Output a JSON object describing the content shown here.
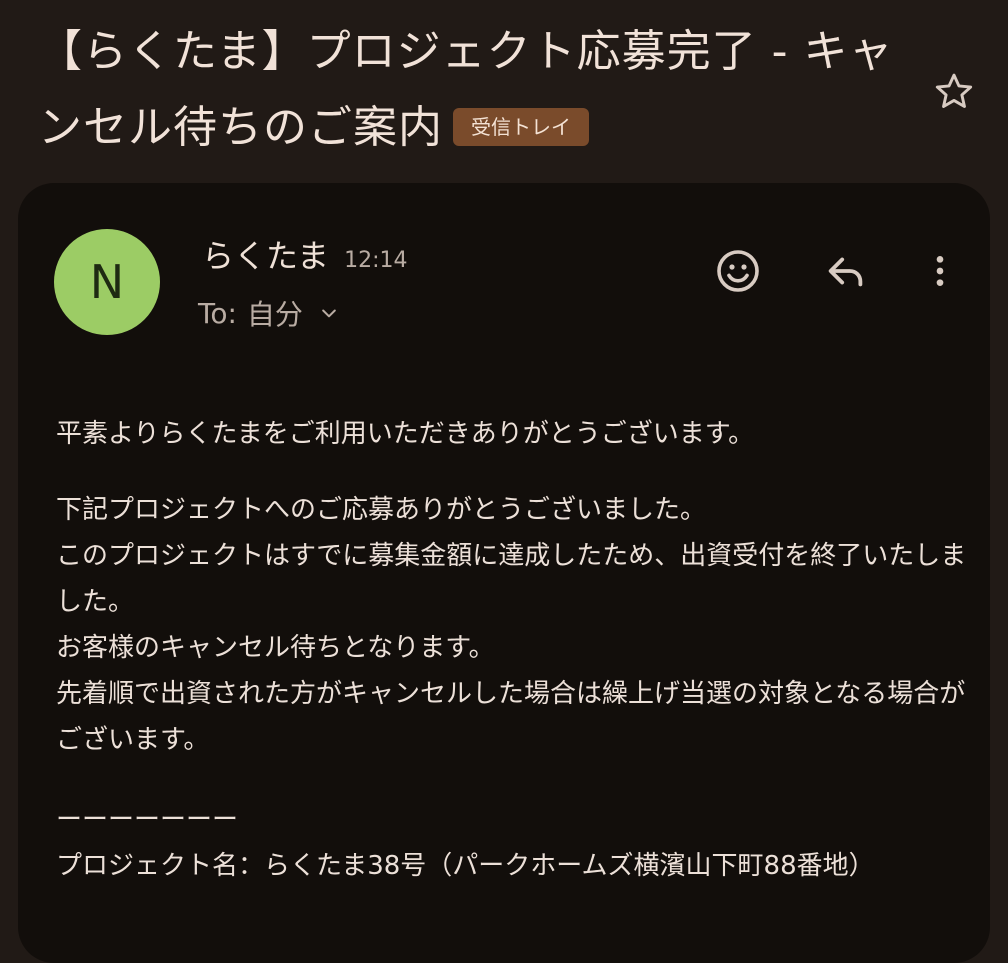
{
  "email": {
    "subject": "【らくたま】プロジェクト応募完了 - キャンセル待ちのご案内",
    "label_badge": "受信トレイ",
    "sender": {
      "initial": "N",
      "name": "らくたま",
      "time": "12:14"
    },
    "recipient": {
      "to_label": "To:",
      "to_value": "自分"
    },
    "body": {
      "greeting": "平素よりらくたまをご利用いただきありがとうございます。",
      "lines": [
        "下記プロジェクトへのご応募ありがとうございました。",
        "このプロジェクトはすでに募集金額に達成したため、出資受付を終了いたしました。",
        "お客様のキャンセル待ちとなります。",
        "先着順で出資された方がキャンセルした場合は繰上げ当選の対象となる場合がございます。"
      ],
      "divider": "ーーーーーーー",
      "project_line": "プロジェクト名：らくたま38号（パークホームズ横濱山下町88番地）"
    }
  },
  "icons": {
    "star": "star-outline-icon",
    "emoji": "smiley-icon",
    "reply": "reply-icon",
    "more": "more-vertical-icon",
    "expand": "chevron-down-icon"
  },
  "colors": {
    "background": "#211a16",
    "card": "#120e0b",
    "avatar": "#9ccc65",
    "badge": "#7a4b2b",
    "text": "#ece0d8",
    "muted": "#b9aca3"
  }
}
